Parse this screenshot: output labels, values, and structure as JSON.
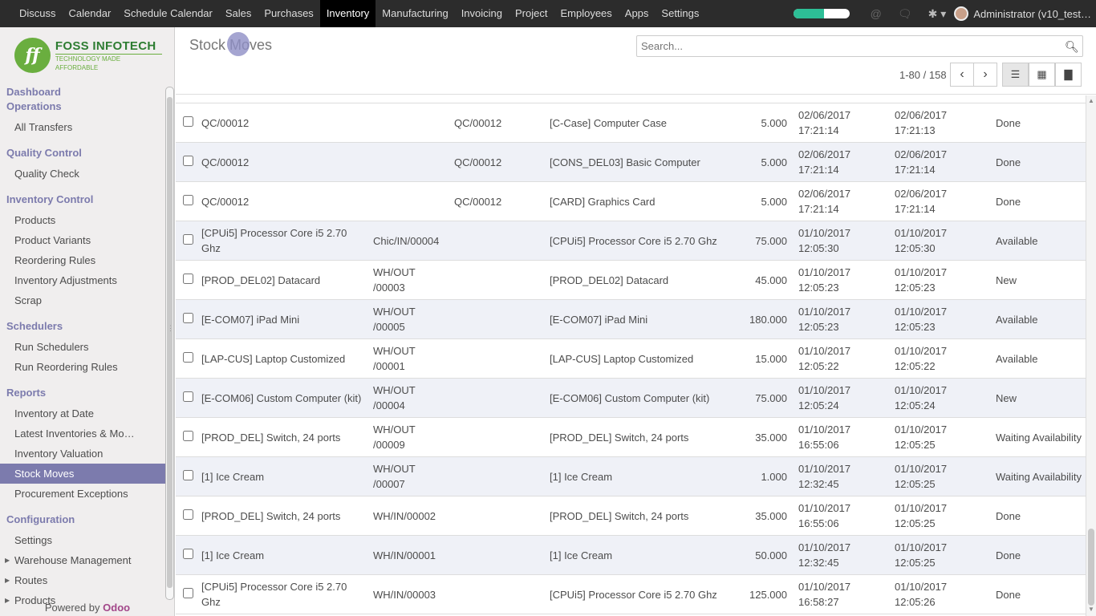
{
  "topmenu": [
    {
      "label": "Discuss"
    },
    {
      "label": "Calendar"
    },
    {
      "label": "Schedule Calendar"
    },
    {
      "label": "Sales"
    },
    {
      "label": "Purchases"
    },
    {
      "label": "Inventory",
      "active": true
    },
    {
      "label": "Manufacturing"
    },
    {
      "label": "Invoicing"
    },
    {
      "label": "Project"
    },
    {
      "label": "Employees"
    },
    {
      "label": "Apps"
    },
    {
      "label": "Settings"
    }
  ],
  "topright": {
    "progress_percent": 55,
    "progress_color": "#2dbe96",
    "user_label": "Administrator (v10_test…"
  },
  "logo": {
    "title": "FOSS INFOTECH",
    "tagline": "TECHNOLOGY MADE AFFORDABLE"
  },
  "sidebar": {
    "sections": [
      {
        "title": "Dashboard Operations",
        "items": [
          {
            "label": "All Transfers"
          }
        ]
      },
      {
        "title": "Quality Control",
        "items": [
          {
            "label": "Quality Check"
          }
        ]
      },
      {
        "title": "Inventory Control",
        "items": [
          {
            "label": "Products"
          },
          {
            "label": "Product Variants"
          },
          {
            "label": "Reordering Rules"
          },
          {
            "label": "Inventory Adjustments"
          },
          {
            "label": "Scrap"
          }
        ]
      },
      {
        "title": "Schedulers",
        "items": [
          {
            "label": "Run Schedulers"
          },
          {
            "label": "Run Reordering Rules"
          }
        ]
      },
      {
        "title": "Reports",
        "items": [
          {
            "label": "Inventory at Date"
          },
          {
            "label": "Latest Inventories & Mo…"
          },
          {
            "label": "Inventory Valuation"
          },
          {
            "label": "Stock Moves",
            "active": true
          },
          {
            "label": "Procurement Exceptions"
          }
        ]
      },
      {
        "title": "Configuration",
        "items": [
          {
            "label": "Settings"
          },
          {
            "label": "Warehouse Management",
            "caret": true
          },
          {
            "label": "Routes",
            "caret": true
          },
          {
            "label": "Products",
            "caret": true
          }
        ]
      }
    ],
    "powered_prefix": "Powered by",
    "powered_brand": "Odoo",
    "accent": "#7c7bad"
  },
  "control_panel": {
    "breadcrumb": "Stock Moves",
    "search_placeholder": "Search...",
    "pager": "1-80 / 158"
  },
  "rows": [
    {
      "ref": "QC/00012",
      "source": "",
      "origin": "QC/00012",
      "product": "[C-Case] Computer Case",
      "qty": "5.000",
      "date_expected": "02/06/2017 17:21:14",
      "date": "02/06/2017 17:21:13",
      "status": "Done"
    },
    {
      "ref": "QC/00012",
      "source": "",
      "origin": "QC/00012",
      "product": "[CONS_DEL03] Basic Computer",
      "qty": "5.000",
      "date_expected": "02/06/2017 17:21:14",
      "date": "02/06/2017 17:21:14",
      "status": "Done"
    },
    {
      "ref": "QC/00012",
      "source": "",
      "origin": "QC/00012",
      "product": "[CARD] Graphics Card",
      "qty": "5.000",
      "date_expected": "02/06/2017 17:21:14",
      "date": "02/06/2017 17:21:14",
      "status": "Done"
    },
    {
      "ref": "[CPUi5] Processor Core i5 2.70 Ghz",
      "source": "Chic/IN/00004",
      "origin": "",
      "product": "[CPUi5] Processor Core i5 2.70 Ghz",
      "qty": "75.000",
      "date_expected": "01/10/2017 12:05:30",
      "date": "01/10/2017 12:05:30",
      "status": "Available"
    },
    {
      "ref": "[PROD_DEL02] Datacard",
      "source": "WH/OUT /00003",
      "origin": "",
      "product": "[PROD_DEL02] Datacard",
      "qty": "45.000",
      "date_expected": "01/10/2017 12:05:23",
      "date": "01/10/2017 12:05:23",
      "status": "New"
    },
    {
      "ref": "[E-COM07] iPad Mini",
      "source": "WH/OUT /00005",
      "origin": "",
      "product": "[E-COM07] iPad Mini",
      "qty": "180.000",
      "date_expected": "01/10/2017 12:05:23",
      "date": "01/10/2017 12:05:23",
      "status": "Available"
    },
    {
      "ref": "[LAP-CUS] Laptop Customized",
      "source": "WH/OUT /00001",
      "origin": "",
      "product": "[LAP-CUS] Laptop Customized",
      "qty": "15.000",
      "date_expected": "01/10/2017 12:05:22",
      "date": "01/10/2017 12:05:22",
      "status": "Available"
    },
    {
      "ref": "[E-COM06] Custom Computer (kit)",
      "source": "WH/OUT /00004",
      "origin": "",
      "product": "[E-COM06] Custom Computer (kit)",
      "qty": "75.000",
      "date_expected": "01/10/2017 12:05:24",
      "date": "01/10/2017 12:05:24",
      "status": "New"
    },
    {
      "ref": "[PROD_DEL] Switch, 24 ports",
      "source": "WH/OUT /00009",
      "origin": "",
      "product": "[PROD_DEL] Switch, 24 ports",
      "qty": "35.000",
      "date_expected": "01/10/2017 16:55:06",
      "date": "01/10/2017 12:05:25",
      "status": "Waiting Availability"
    },
    {
      "ref": "[1] Ice Cream",
      "source": "WH/OUT /00007",
      "origin": "",
      "product": "[1] Ice Cream",
      "qty": "1.000",
      "date_expected": "01/10/2017 12:32:45",
      "date": "01/10/2017 12:05:25",
      "status": "Waiting Availability"
    },
    {
      "ref": "[PROD_DEL] Switch, 24 ports",
      "source": "WH/IN/00002",
      "origin": "",
      "product": "[PROD_DEL] Switch, 24 ports",
      "qty": "35.000",
      "date_expected": "01/10/2017 16:55:06",
      "date": "01/10/2017 12:05:25",
      "status": "Done"
    },
    {
      "ref": "[1] Ice Cream",
      "source": "WH/IN/00001",
      "origin": "",
      "product": "[1] Ice Cream",
      "qty": "50.000",
      "date_expected": "01/10/2017 12:32:45",
      "date": "01/10/2017 12:05:25",
      "status": "Done"
    },
    {
      "ref": "[CPUi5] Processor Core i5 2.70 Ghz",
      "source": "WH/IN/00003",
      "origin": "",
      "product": "[CPUi5] Processor Core i5 2.70 Ghz",
      "qty": "125.000",
      "date_expected": "01/10/2017 16:58:27",
      "date": "01/10/2017 12:05:26",
      "status": "Done"
    }
  ]
}
